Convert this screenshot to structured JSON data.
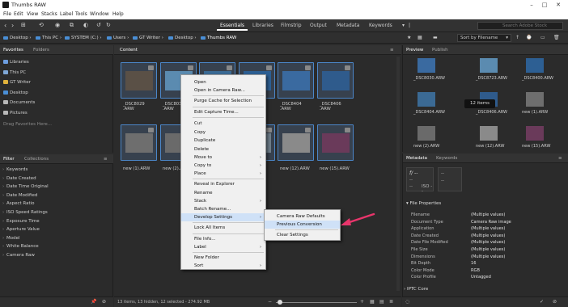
{
  "window": {
    "title": "Thumbs RAW",
    "minimize": "–",
    "maximize": "□",
    "close": "✕"
  },
  "menu": [
    "File",
    "Edit",
    "View",
    "Stacks",
    "Label",
    "Tools",
    "Window",
    "Help"
  ],
  "workspaces": [
    "Essentials",
    "Libraries",
    "Filmstrip",
    "Output",
    "Metadata",
    "Keywords"
  ],
  "active_workspace": "Essentials",
  "search": {
    "placeholder": "Search Adobe Stock"
  },
  "sort": {
    "label": "Sort by Filename"
  },
  "breadcrumb": [
    "Desktop",
    "This PC",
    "SYSTEM (C:)",
    "Users",
    "GT Writer",
    "Desktop",
    "Thumbs RAW"
  ],
  "left_tabs": {
    "favorites": "Favorites",
    "folders": "Folders"
  },
  "favorites": [
    {
      "label": "Libraries",
      "color": "#6d9ee0"
    },
    {
      "label": "This PC",
      "color": "#7fa8d8"
    },
    {
      "label": "GT Writer",
      "color": "#e0b23c"
    },
    {
      "label": "Desktop",
      "color": "#4a8fd6"
    },
    {
      "label": "Documents",
      "color": "#b8b8b8"
    },
    {
      "label": "Pictures",
      "color": "#b8b8b8"
    }
  ],
  "favorites_hint": "Drag Favorites Here...",
  "filter_tabs": {
    "filter": "Filter",
    "collections": "Collections"
  },
  "filters": [
    "Keywords",
    "Date Created",
    "Date Time Original",
    "Date Modified",
    "Aspect Ratio",
    "ISO Speed Ratings",
    "Exposure Time",
    "Aperture Value",
    "Model",
    "White Balance",
    "Camera Raw"
  ],
  "content_tab": "Content",
  "thumbs_row1": [
    {
      "label": "_DSC8029 .ARW",
      "color": "#5a5046"
    },
    {
      "label": "_DSC8030 .ARW",
      "color": "#5b8bb0"
    },
    {
      "label": "",
      "color": "#3b6a94"
    },
    {
      "label": "_DSC8400 .ARW",
      "color": "#2d5f93"
    },
    {
      "label": "_DSC8404 .ARW",
      "color": "#3a6aa0"
    },
    {
      "label": "_DSC8406 .ARW",
      "color": "#2f5b8c"
    }
  ],
  "thumbs_row2": [
    {
      "label": "new (1).ARW",
      "color": "#6e6e6e"
    },
    {
      "label": "new (2).ARW",
      "color": "#6a6a6a"
    },
    {
      "label": "",
      "color": "#8a7a5a"
    },
    {
      "label": "",
      "color": "#6d7d8a"
    },
    {
      "label": "new (12).ARW",
      "color": "#8a8a8a"
    },
    {
      "label": "new (15).ARW",
      "color": "#6a3a5a"
    }
  ],
  "context_menu": [
    "Open",
    "Open in Camera Raw...",
    "Purge Cache for Selection",
    "Edit Capture Time...",
    "Cut",
    "Copy",
    "Duplicate",
    "Delete",
    "Move to",
    "Copy to",
    "Place",
    "Reveal in Explorer",
    "Rename",
    "Stack",
    "Batch Rename...",
    "Develop Settings",
    "Lock All Items",
    "File Info...",
    "Label",
    "New Folder",
    "Sort"
  ],
  "submenu": [
    "Camera Raw Defaults",
    "Previous Conversion",
    "Clear Settings"
  ],
  "status": {
    "text": "13 items, 13 hidden, 12 selected - 274.92 MB"
  },
  "right_tabs": {
    "preview": "Preview",
    "publish": "Publish",
    "metadata": "Metadata",
    "keywords": "Keywords"
  },
  "preview_labels": [
    "_DSC8030.ARW",
    "_DSC8723.ARW",
    "_DSC8400.ARW",
    "_DSC8404.ARW",
    "_DSC8406.ARW",
    "new (1).ARW",
    "new (2).ARW",
    "new (12).ARW",
    "new (15).ARW"
  ],
  "preview_badge": "12 items",
  "metadata_placeholder": {
    "aperture": "f/ --",
    "dash": "--",
    "iso": "ISO --"
  },
  "file_properties_title": "File Properties",
  "file_properties": [
    {
      "k": "Filename",
      "v": "(Multiple values)"
    },
    {
      "k": "Document Type",
      "v": "Camera Raw image"
    },
    {
      "k": "Application",
      "v": "(Multiple values)"
    },
    {
      "k": "Date Created",
      "v": "(Multiple values)"
    },
    {
      "k": "Date File Modified",
      "v": "(Multiple values)"
    },
    {
      "k": "File Size",
      "v": "(Multiple values)"
    },
    {
      "k": "Dimensions",
      "v": "(Multiple values)"
    },
    {
      "k": "Bit Depth",
      "v": "16"
    },
    {
      "k": "Color Mode",
      "v": "RGB"
    },
    {
      "k": "Color Profile",
      "v": "Untagged"
    }
  ],
  "iptc_title": "IPTC Core",
  "colors": {
    "accent": "#4b86c8",
    "arrow": "#e8356b",
    "menu_highlight": "#cfe1f7"
  }
}
